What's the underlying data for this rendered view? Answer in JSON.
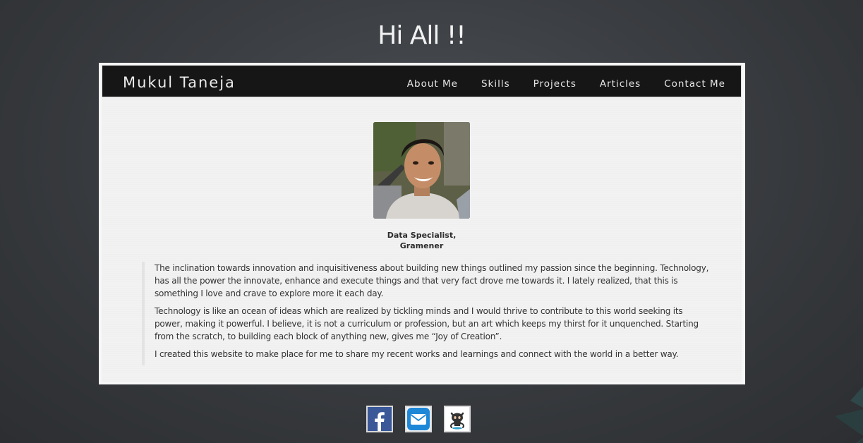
{
  "greeting": "Hi All !!",
  "navbar": {
    "brand": "Mukul Taneja",
    "links": [
      "About Me",
      "Skills",
      "Projects",
      "Articles",
      "Contact Me"
    ]
  },
  "profile": {
    "job_title_line1": "Data Specialist,",
    "job_title_line2": "Gramener"
  },
  "about": {
    "paragraphs": [
      "The inclination towards innovation and inquisitiveness about building new things outlined my passion since the beginning. Technology, has all the power the innovate, enhance and execute things and that very fact drove me towards it. I lately realized, that this is something I love and crave to explore more it each day.",
      "Technology is like an ocean of ideas which are realized by tickling minds and I would thrive to contribute to this world seeking its power, making it powerful. I believe, it is not a curriculum or profession, but an art which keeps my thirst for it unquenched. Starting from the scratch, to building each block of anything new, gives me “Joy of Creation”.",
      "I created this website to make place for me to share my recent works and learnings and connect with the world in a better way."
    ]
  },
  "socials": {
    "icons": [
      "facebook-icon",
      "email-icon",
      "github-icon"
    ],
    "colors": {
      "facebook": "#3b5998",
      "email": "#1e88d8",
      "github": "#333333"
    }
  }
}
